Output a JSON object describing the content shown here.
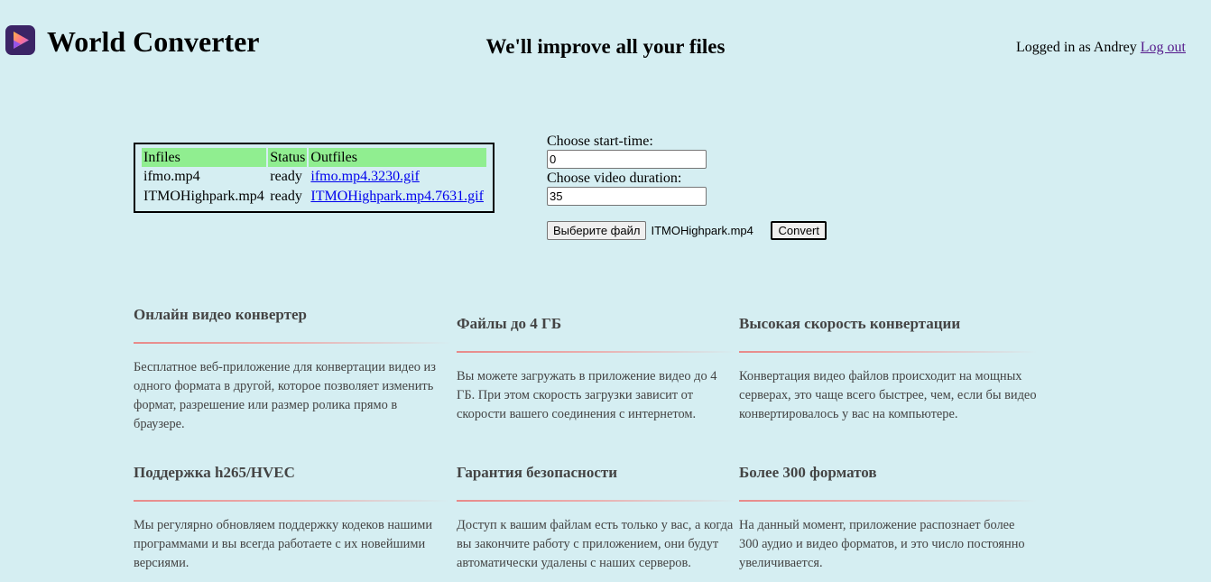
{
  "header": {
    "app_title": "World Converter",
    "tagline": "We'll improve all your files",
    "logged_in_text": "Logged in as Andrey",
    "logout_label": "Log out"
  },
  "files_table": {
    "columns": [
      "Infiles",
      "Status",
      "Outfiles"
    ],
    "rows": [
      {
        "infile": "ifmo.mp4",
        "status": "ready",
        "outfile": "ifmo.mp4.3230.gif"
      },
      {
        "infile": "ITMOHighpark.mp4",
        "status": "ready",
        "outfile": "ITMOHighpark.mp4.7631.gif"
      }
    ]
  },
  "convert_form": {
    "start_time_label": "Choose start-time:",
    "start_time_value": "0",
    "duration_label": "Choose video duration:",
    "duration_value": "35",
    "choose_file_label": "Выберите файл",
    "selected_file": "ITMOHighpark.mp4",
    "convert_label": "Convert"
  },
  "features": [
    {
      "title": "Онлайн видео конвертер",
      "text": "Бесплатное веб-приложение для конвертации видео из одного формата в другой, которое позволяет изменить формат, разрешение или размер ролика прямо в браузере."
    },
    {
      "title": "Файлы до 4 ГБ",
      "text": "Вы можете загружать в приложение видео до 4 ГБ. При этом скорость загрузки зависит от скорости вашего соединения с интернетом."
    },
    {
      "title": "Высокая скорость конвертации",
      "text": "Конвертация видео файлов происходит на мощных серверах, это чаще всего быстрее, чем, если бы видео конвертировалось у вас на компьютере."
    },
    {
      "title": "Поддержка h265/HVEC",
      "text": "Мы регулярно обновляем поддержку кодеков нашими программами и вы всегда работаете с их новейшими версиями."
    },
    {
      "title": "Гарантия безопасности",
      "text": "Доступ к вашим файлам есть только у вас, а когда вы закончите работу с приложением, они будут автоматически удалены с наших серверов."
    },
    {
      "title": "Более 300 форматов",
      "text": "На данный момент, приложение распознает более 300 аудио и видео форматов, и это число постоянно увеличивается."
    }
  ],
  "colors": {
    "background": "#d5eef2",
    "table_header": "#90ee90",
    "link": "#0000ee",
    "visited_link": "#551a8b",
    "feature_rule": "#e88a8a"
  }
}
